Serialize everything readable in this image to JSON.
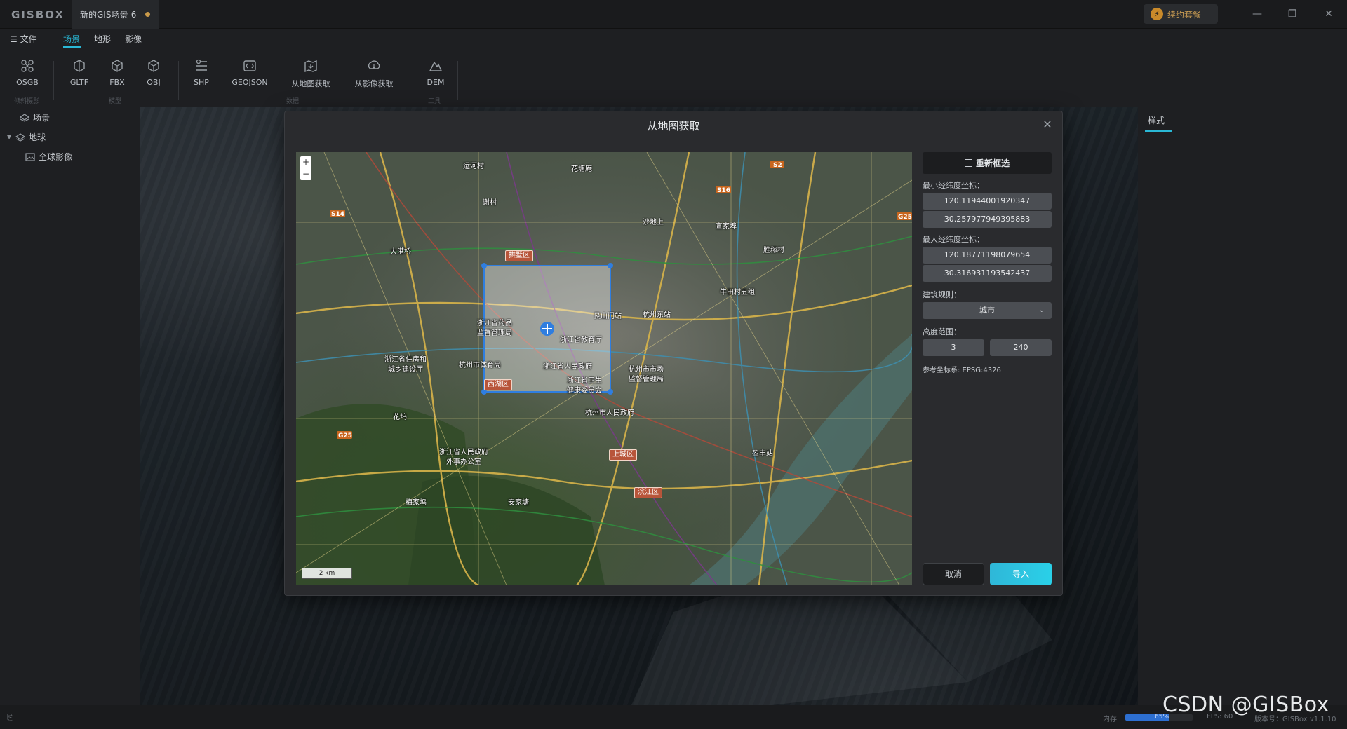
{
  "app": {
    "logo": "GISBOX",
    "doc_tab": "新的GIS场景-6",
    "renew_label": "续约套餐"
  },
  "menu": {
    "file": "文件",
    "tabs": [
      "场景",
      "地形",
      "影像"
    ],
    "active_tab": "场景"
  },
  "ribbon": {
    "buttons": [
      {
        "label": "OSGB",
        "icon": "osgb-icon"
      },
      {
        "label": "GLTF",
        "icon": "gltf-icon"
      },
      {
        "label": "FBX",
        "icon": "fbx-icon"
      },
      {
        "label": "OBJ",
        "icon": "obj-icon"
      },
      {
        "label": "SHP",
        "icon": "shp-icon"
      },
      {
        "label": "GEOJSON",
        "icon": "geojson-icon"
      },
      {
        "label": "从地图获取",
        "icon": "map-fetch-icon"
      },
      {
        "label": "从影像获取",
        "icon": "image-fetch-icon"
      },
      {
        "label": "DEM",
        "icon": "dem-icon"
      }
    ],
    "groups": [
      "倾斜摄影",
      "模型",
      "数据",
      "工具"
    ]
  },
  "tree": {
    "scene": "场景",
    "earth": "地球",
    "global_imagery": "全球影像"
  },
  "right_panel": {
    "tab": "样式"
  },
  "status": {
    "memory_label": "内存",
    "memory_value": "65%",
    "memory_fraction": 0.65,
    "fps": "FPS: 60",
    "version": "版本号：GISBox v1.1.10"
  },
  "watermark": "CSDN @GISBox",
  "dialog": {
    "title": "从地图获取",
    "reselect_label": "重新框选",
    "min_label": "最小经纬度坐标：",
    "min_lon": "120.11944001920347",
    "min_lat": "30.257977949395883",
    "max_label": "最大经纬度坐标：",
    "max_lon": "120.18771198079654",
    "max_lat": "30.316931193542437",
    "rule_label": "建筑规则：",
    "rule_value": "城市",
    "height_label": "高度范围：",
    "height_min": "3",
    "height_max": "240",
    "crs": "参考坐标系: EPSG:4326",
    "cancel": "取消",
    "import": "导入"
  },
  "map": {
    "zoom_in": "+",
    "zoom_out": "−",
    "scale": "2 km",
    "places": [
      "运河村",
      "花塘庵",
      "谢村",
      "沙地上",
      "宣家埠",
      "大港桥",
      "胜稼村",
      "拱墅区",
      "牛田村五组",
      "浙江省药品\n监督管理局",
      "浙江省教育厅",
      "艮山门站",
      "杭州东站",
      "浙江省住房和\n城乡建设厅",
      "杭州市体育局",
      "浙江省人民政府",
      "浙江省卫生\n健康委员会",
      "杭州市市场\n监督管理局",
      "西湖区",
      "杭州市人民政府",
      "花坞",
      "浙江省人民政府\n外事办公室",
      "上城区",
      "滨江区",
      "梅家坞",
      "安家塘",
      "盈丰站"
    ],
    "roads": [
      "S2",
      "S16",
      "S14",
      "G25",
      "G25"
    ]
  }
}
